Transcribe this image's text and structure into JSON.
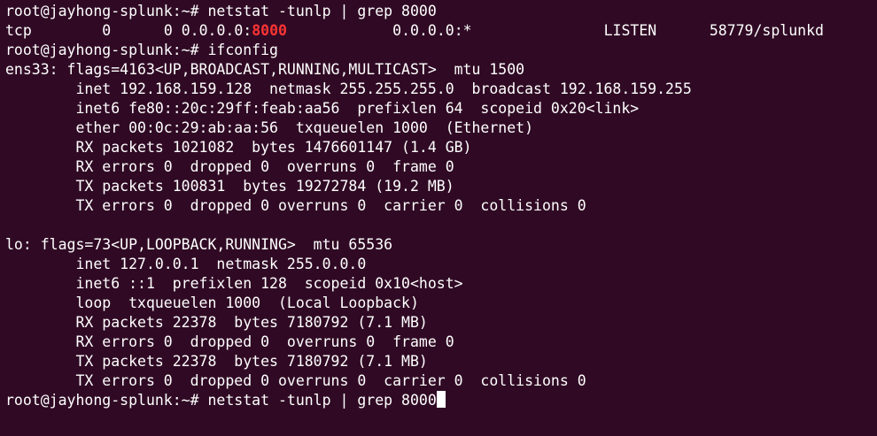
{
  "terminal": {
    "background": "#300a24",
    "foreground": "#ffffff",
    "highlight_color": "#ff3434",
    "lines": [
      "root@jayhong-splunk:~# netstat -tunlp | grep 8000",
      "",
      "root@jayhong-splunk:~# ifconfig",
      "ens33: flags=4163<UP,BROADCAST,RUNNING,MULTICAST>  mtu 1500",
      "        inet 192.168.159.128  netmask 255.255.255.0  broadcast 192.168.159.255",
      "        inet6 fe80::20c:29ff:feab:aa56  prefixlen 64  scopeid 0x20<link>",
      "        ether 00:0c:29:ab:aa:56  txqueuelen 1000  (Ethernet)",
      "        RX packets 1021082  bytes 1476601147 (1.4 GB)",
      "        RX errors 0  dropped 0  overruns 0  frame 0",
      "        TX packets 100831  bytes 19272784 (19.2 MB)",
      "        TX errors 0  dropped 0 overruns 0  carrier 0  collisions 0",
      "",
      "lo: flags=73<UP,LOOPBACK,RUNNING>  mtu 65536",
      "        inet 127.0.0.1  netmask 255.0.0.0",
      "        inet6 ::1  prefixlen 128  scopeid 0x10<host>",
      "        loop  txqueuelen 1000  (Local Loopback)",
      "        RX packets 22378  bytes 7180792 (7.1 MB)",
      "        RX errors 0  dropped 0  overruns 0  frame 0",
      "        TX packets 22378  bytes 7180792 (7.1 MB)",
      "        TX errors 0  dropped 0 overruns 0  carrier 0  collisions 0",
      "root@jayhong-splunk:~# netstat -tunlp | grep 8000"
    ],
    "netstat_row": {
      "proto": "tcp",
      "recv_q": "0",
      "send_q": "0",
      "local_prefix": "0.0.0.0:",
      "local_port": "8000",
      "foreign": "0.0.0.0:*",
      "state": "LISTEN",
      "pid_program": "58779/splunkd"
    }
  }
}
